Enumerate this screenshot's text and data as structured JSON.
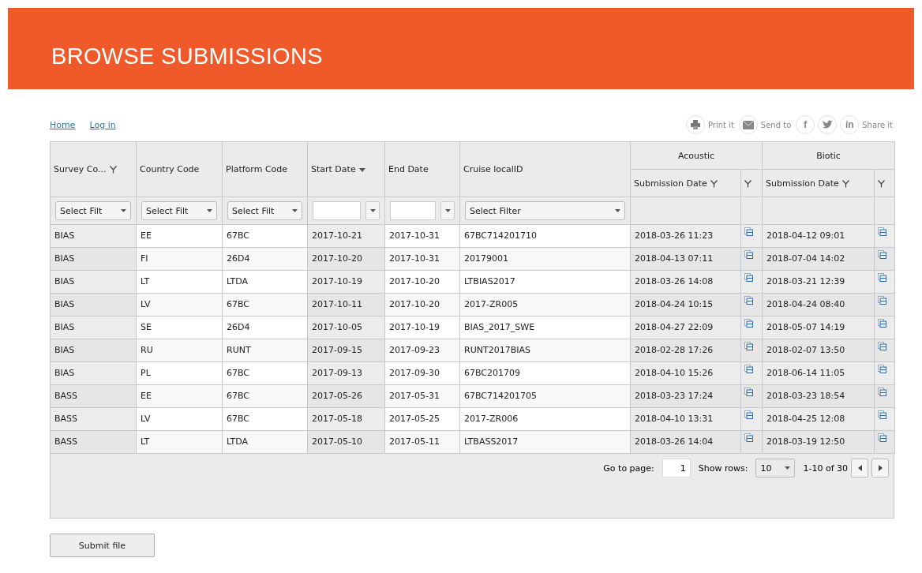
{
  "header": {
    "title": "BROWSE SUBMISSIONS"
  },
  "nav_links": [
    "Home",
    "Log in"
  ],
  "share_bar": [
    {
      "kind": "print",
      "label": "Print it"
    },
    {
      "kind": "mail",
      "label": "Send to"
    },
    {
      "kind": "facebook",
      "glyph": "f"
    },
    {
      "kind": "twitter"
    },
    {
      "kind": "linkedin",
      "glyph": "in",
      "label": "Share it"
    }
  ],
  "table": {
    "columns": [
      {
        "label": "Survey Co...",
        "filter_icon": true,
        "sorted": false,
        "filter": {
          "kind": "select",
          "placeholder": "Select Filt"
        }
      },
      {
        "label": "Country Code",
        "filter_icon": false,
        "sorted": false,
        "filter": {
          "kind": "select",
          "placeholder": "Select Filt"
        }
      },
      {
        "label": "Platform Code",
        "filter_icon": false,
        "sorted": false,
        "filter": {
          "kind": "select",
          "placeholder": "Select Filt"
        }
      },
      {
        "label": "Start Date",
        "filter_icon": false,
        "sorted": true,
        "filter": {
          "kind": "date"
        }
      },
      {
        "label": "End Date",
        "filter_icon": false,
        "sorted": false,
        "filter": {
          "kind": "date"
        }
      },
      {
        "label": "Cruise localID",
        "filter_icon": false,
        "sorted": false,
        "filter": {
          "kind": "select",
          "placeholder": "Select Filter"
        }
      }
    ],
    "groups": [
      {
        "label": "Acoustic",
        "columns": [
          {
            "label": "Submission Date",
            "filter_icon": true
          },
          {
            "filter_icon": true
          }
        ]
      },
      {
        "label": "Biotic",
        "columns": [
          {
            "label": "Submission Date",
            "filter_icon": true
          },
          {
            "filter_icon": true
          }
        ]
      }
    ],
    "rows": [
      {
        "cells": [
          "BIAS",
          "EE",
          "67BC",
          "2017-10-21",
          "2017-10-31",
          "67BC714201710"
        ],
        "acoustic": "2018-03-26 11:23",
        "biotic": "2018-04-12 09:01"
      },
      {
        "cells": [
          "BIAS",
          "FI",
          "26D4",
          "2017-10-20",
          "2017-10-31",
          "20179001"
        ],
        "acoustic": "2018-04-13 07:11",
        "biotic": "2018-07-04 14:02"
      },
      {
        "cells": [
          "BIAS",
          "LT",
          "LTDA",
          "2017-10-19",
          "2017-10-20",
          "LTBIAS2017"
        ],
        "acoustic": "2018-03-26 14:08",
        "biotic": "2018-03-21 12:39"
      },
      {
        "cells": [
          "BIAS",
          "LV",
          "67BC",
          "2017-10-11",
          "2017-10-20",
          "2017-ZR005"
        ],
        "acoustic": "2018-04-24 10:15",
        "biotic": "2018-04-24 08:40"
      },
      {
        "cells": [
          "BIAS",
          "SE",
          "26D4",
          "2017-10-05",
          "2017-10-19",
          "BIAS_2017_SWE"
        ],
        "acoustic": "2018-04-27 22:09",
        "biotic": "2018-05-07 14:19"
      },
      {
        "cells": [
          "BIAS",
          "RU",
          "RUNT",
          "2017-09-15",
          "2017-09-23",
          "RUNT2017BIAS"
        ],
        "acoustic": "2018-02-28 17:26",
        "biotic": "2018-02-07 13:50"
      },
      {
        "cells": [
          "BIAS",
          "PL",
          "67BC",
          "2017-09-13",
          "2017-09-30",
          "67BC201709"
        ],
        "acoustic": "2018-04-10 15:26",
        "biotic": "2018-06-14 11:05"
      },
      {
        "cells": [
          "BASS",
          "EE",
          "67BC",
          "2017-05-26",
          "2017-05-31",
          "67BC714201705"
        ],
        "acoustic": "2018-03-23 17:24",
        "biotic": "2018-03-23 18:54"
      },
      {
        "cells": [
          "BASS",
          "LV",
          "67BC",
          "2017-05-18",
          "2017-05-25",
          "2017-ZR006"
        ],
        "acoustic": "2018-04-10 13:31",
        "biotic": "2018-04-25 12:08"
      },
      {
        "cells": [
          "BASS",
          "LT",
          "LTDA",
          "2017-05-10",
          "2017-05-11",
          "LTBASS2017"
        ],
        "acoustic": "2018-03-26 14:04",
        "biotic": "2018-03-19 12:50"
      }
    ],
    "pager": {
      "goto_label": "Go to page:",
      "page": "1",
      "rows_label": "Show rows:",
      "rows_value": "10",
      "range": "1-10 of 30"
    }
  },
  "submit_button": "Submit file"
}
